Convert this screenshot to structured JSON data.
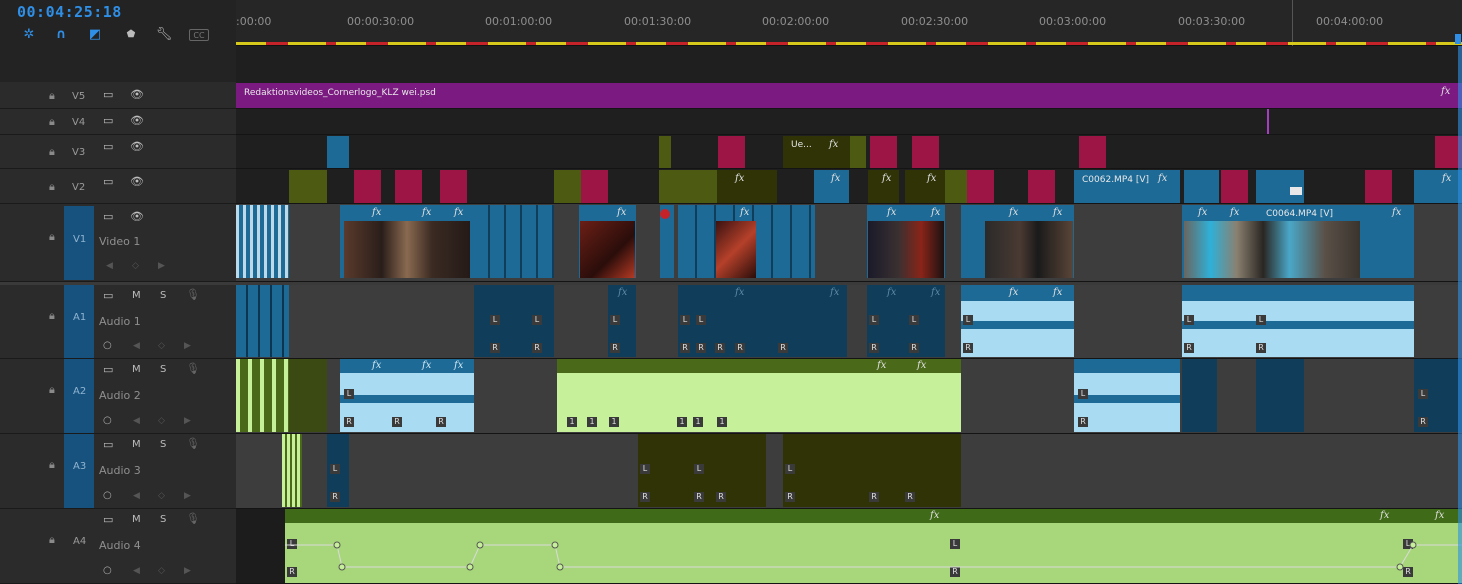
{
  "timecode": "00:04:25:18",
  "toolbar": {
    "icons": [
      "snap-icon",
      "linked-selection-icon",
      "add-marker-icon",
      "marker-icon",
      "wrench-icon",
      "captions-icon"
    ],
    "captions_label": "CC"
  },
  "ruler": {
    "labels": [
      ":00:00",
      "00:00:30:00",
      "00:01:00:00",
      "00:01:30:00",
      "00:02:00:00",
      "00:02:30:00",
      "00:03:00:00",
      "00:03:30:00",
      "00:04:00:00"
    ]
  },
  "tracks": {
    "v5": {
      "id": "V5"
    },
    "v4": {
      "id": "V4"
    },
    "v3": {
      "id": "V3"
    },
    "v2": {
      "id": "V2"
    },
    "v1": {
      "id": "V1",
      "name": "Video 1"
    },
    "a1": {
      "id": "A1",
      "name": "Audio 1",
      "mute": "M",
      "solo": "S"
    },
    "a2": {
      "id": "A2",
      "name": "Audio 2",
      "mute": "M",
      "solo": "S"
    },
    "a3": {
      "id": "A3",
      "name": "Audio 3",
      "mute": "M",
      "solo": "S"
    },
    "a4": {
      "id": "A4",
      "name": "Audio 4",
      "mute": "M",
      "solo": "S"
    }
  },
  "clips": {
    "v5_title": "Redaktionsvideos_Cornerlogo_KLZ wei.psd",
    "v3_ue": "Ue...",
    "v2_c0062": "C0062.MP4 [V]",
    "v1_c0064": "C0064.MP4 [V]",
    "fx": "fx",
    "L": "L",
    "R": "R",
    "one": "1"
  },
  "colors": {
    "timecode": "#2f8fe6",
    "video_clip": "#1d6a96",
    "adjustment": "#7b1b82",
    "transition_red": "#9c1545",
    "olive": "#4c5a12",
    "audio_green": "#c7f09a",
    "audio_blue": "#a9dbf2",
    "track_target": "#17517e"
  }
}
